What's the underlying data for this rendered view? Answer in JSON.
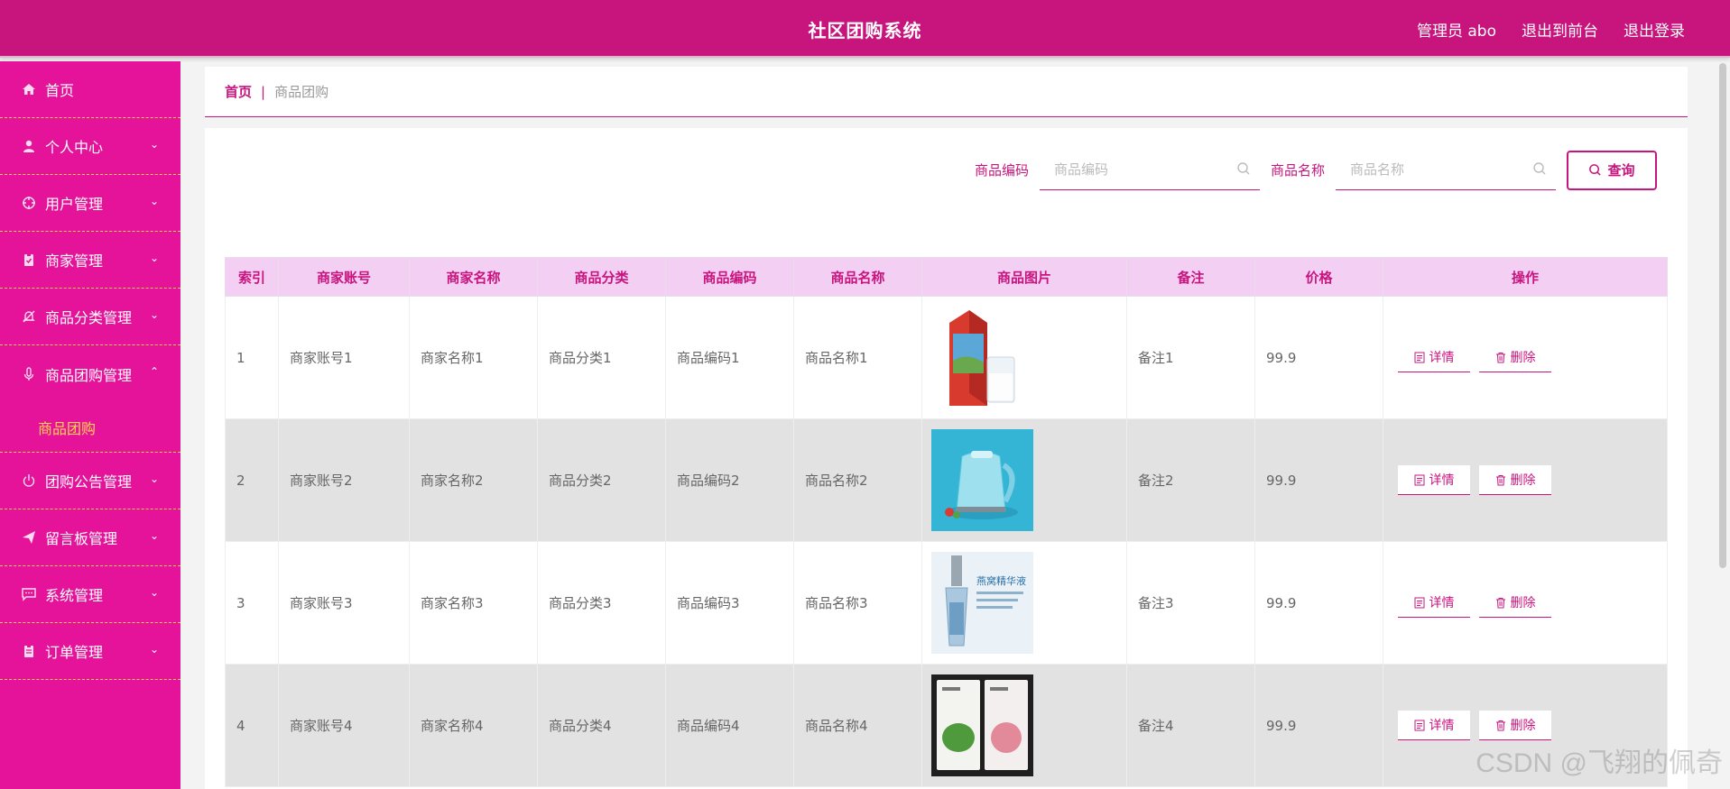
{
  "header": {
    "title": "社区团购系统",
    "admin": "管理员 abo",
    "back_front": "退出到前台",
    "logout": "退出登录"
  },
  "sidebar": {
    "items": [
      {
        "label": "首页",
        "icon": "home-icon"
      },
      {
        "label": "个人中心",
        "icon": "user-icon"
      },
      {
        "label": "用户管理",
        "icon": "crosshair-icon"
      },
      {
        "label": "商家管理",
        "icon": "clipboard-icon"
      },
      {
        "label": "商品分类管理",
        "icon": "bell-off-icon"
      },
      {
        "label": "商品团购管理",
        "icon": "microphone-icon"
      },
      {
        "label": "团购公告管理",
        "icon": "power-icon"
      },
      {
        "label": "留言板管理",
        "icon": "send-icon"
      },
      {
        "label": "系统管理",
        "icon": "chat-icon"
      },
      {
        "label": "订单管理",
        "icon": "clipboard-list-icon"
      }
    ],
    "submenu_active": "商品团购"
  },
  "breadcrumb": {
    "home": "首页",
    "separator": "|",
    "current": "商品团购"
  },
  "search": {
    "code_label": "商品编码",
    "code_placeholder": "商品编码",
    "name_label": "商品名称",
    "name_placeholder": "商品名称",
    "query_button": "查询"
  },
  "table": {
    "headers": [
      "索引",
      "商家账号",
      "商家名称",
      "商品分类",
      "商品编码",
      "商品名称",
      "商品图片",
      "备注",
      "价格",
      "操作"
    ],
    "rows": [
      {
        "index": "1",
        "account": "商家账号1",
        "merchant": "商家名称1",
        "category": "商品分类1",
        "code": "商品编码1",
        "name": "商品名称1",
        "note": "备注1",
        "price": "99.9",
        "image": "milk-carton-image"
      },
      {
        "index": "2",
        "account": "商家账号2",
        "merchant": "商家名称2",
        "category": "商品分类2",
        "code": "商品编码2",
        "name": "商品名称2",
        "note": "备注2",
        "price": "99.9",
        "image": "electric-kettle-image"
      },
      {
        "index": "3",
        "account": "商家账号3",
        "merchant": "商家名称3",
        "category": "商品分类3",
        "code": "商品编码3",
        "name": "商品名称3",
        "note": "备注3",
        "price": "99.9",
        "image": "serum-bottle-image",
        "image_text": "燕窝精华液"
      },
      {
        "index": "4",
        "account": "商家账号4",
        "merchant": "商家名称4",
        "category": "商品分类4",
        "code": "商品编码4",
        "name": "商品名称4",
        "note": "备注4",
        "price": "99.9",
        "image": "face-mask-packs-image"
      }
    ],
    "detail_button": "详情",
    "delete_button": "删除"
  },
  "watermark": "CSDN @飞翔的佩奇",
  "colors": {
    "primary": "#c8157e",
    "sidebar": "#e5139a",
    "header_bg": "#f3cff4",
    "accent": "#ffd54a"
  }
}
